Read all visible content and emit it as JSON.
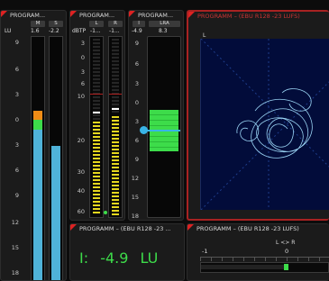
{
  "panel1": {
    "title": "PROGRAM...",
    "channels": [
      "M",
      "S"
    ],
    "unit": "LU",
    "readings": [
      "1.6",
      "-2.2"
    ],
    "scale": [
      "9",
      "6",
      "3",
      "0",
      "3",
      "6",
      "9",
      "12",
      "15",
      "18"
    ]
  },
  "panel2": {
    "title": "PROGRAM...",
    "channels": [
      "L",
      "R"
    ],
    "unit": "dBTP",
    "readings": [
      "-1...",
      "-1..."
    ],
    "scale": [
      "3",
      "0",
      "3",
      "6",
      "10",
      "20",
      "30",
      "40",
      "60"
    ]
  },
  "panel3": {
    "title": "PROGRAM...",
    "channels": [
      "I",
      "LRA"
    ],
    "readings": [
      "-4.9",
      "8.3"
    ],
    "scale": [
      "9",
      "6",
      "3",
      "0",
      "3",
      "6",
      "9",
      "12",
      "15",
      "18"
    ]
  },
  "vector": {
    "title": "PROGRAMM – (EBU R128 -23 LUFS)",
    "channel_label": "L"
  },
  "readout": {
    "title": "PROGRAMM – (EBU R128 -23 ...",
    "label": "I:",
    "value": "-4.9",
    "unit": "LU"
  },
  "balance": {
    "title": "PROGRAMM – (EBU R128 -23 LUFS)",
    "axis_label": "L <> R",
    "left_tick": "-1",
    "center_tick": "0",
    "position": 0.35
  },
  "colors": {
    "accent_red": "#d22222",
    "meter_blue": "#4fb3d9",
    "meter_green": "#3ddc4a",
    "meter_orange": "#f08c16",
    "meter_yellow": "#e6d81e",
    "readout_green": "#3ddc4a",
    "vector_bg": "#020c3a",
    "vector_trace": "#9ad4f4"
  }
}
